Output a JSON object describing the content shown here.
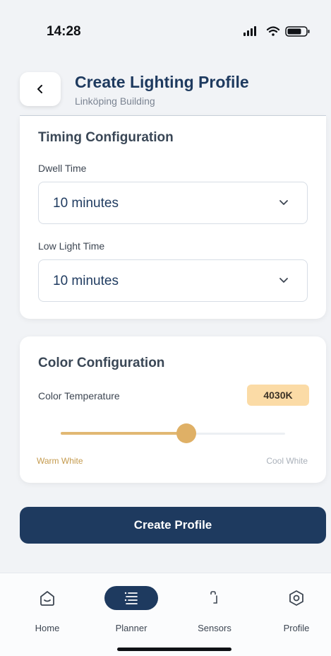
{
  "status_bar": {
    "time": "14:28"
  },
  "header": {
    "title": "Create Lighting Profile",
    "subtitle": "Linköping Building"
  },
  "timing": {
    "title": "Timing Configuration",
    "dwell_label": "Dwell Time",
    "dwell_value": "10 minutes",
    "low_light_label": "Low Light Time",
    "low_light_value": "10 minutes"
  },
  "color": {
    "title": "Color Configuration",
    "temp_label": "Color Temperature",
    "temp_value": "4030K",
    "slider_fraction": 0.56,
    "warm_label": "Warm White",
    "cool_label": "Cool White"
  },
  "actions": {
    "create_label": "Create Profile"
  },
  "tabs": [
    {
      "label": "Home",
      "icon": "home-icon"
    },
    {
      "label": "Planner",
      "icon": "planner-icon",
      "active": true
    },
    {
      "label": "Sensors",
      "icon": "sensor-icon"
    },
    {
      "label": "Profile",
      "icon": "profile-icon"
    }
  ],
  "colors": {
    "primary": "#1e3a5f",
    "accent": "#dfb066",
    "badge": "#fbdba6"
  }
}
